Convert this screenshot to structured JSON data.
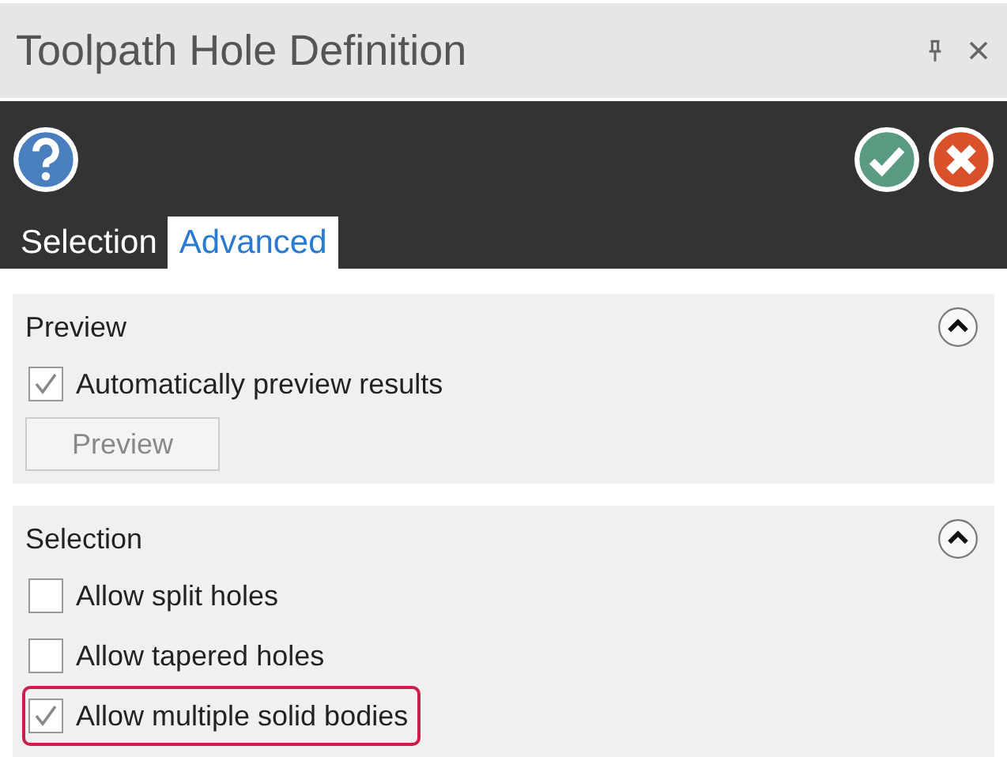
{
  "window": {
    "title": "Toolpath Hole Definition"
  },
  "tabs": [
    {
      "label": "Selection",
      "selected": false
    },
    {
      "label": "Advanced",
      "selected": true
    }
  ],
  "sections": [
    {
      "title": "Preview",
      "expanded": true,
      "checkboxes": [
        {
          "label": "Automatically preview results",
          "checked": true,
          "highlighted": false
        }
      ],
      "button": {
        "label": "Preview",
        "disabled": true
      }
    },
    {
      "title": "Selection",
      "expanded": true,
      "checkboxes": [
        {
          "label": "Allow split holes",
          "checked": false,
          "highlighted": false
        },
        {
          "label": "Allow tapered holes",
          "checked": false,
          "highlighted": false
        },
        {
          "label": "Allow multiple solid bodies",
          "checked": true,
          "highlighted": true
        }
      ]
    }
  ]
}
